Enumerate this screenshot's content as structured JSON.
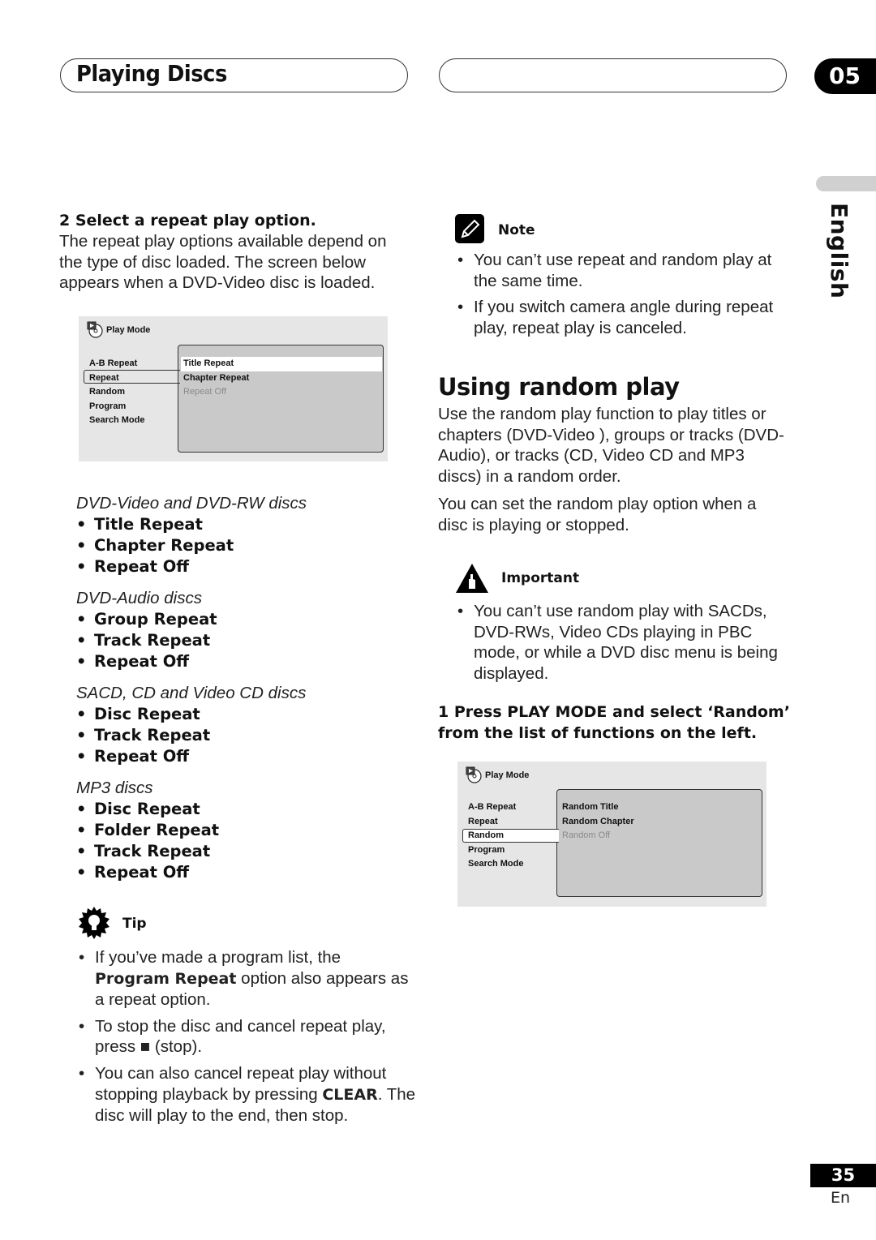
{
  "header": {
    "section_title": "Playing Discs",
    "chapter_number": "05",
    "language_tab": "English"
  },
  "left": {
    "step2_heading": "2   Select a repeat play option.",
    "step2_body": "The repeat play options available depend on the type of disc loaded. The screen below appears when a DVD-Video disc is loaded.",
    "osd": {
      "title": "Play Mode",
      "menu": [
        "A-B Repeat",
        "Repeat",
        "Random",
        "Program",
        "Search Mode"
      ],
      "selected_menu_index": 1,
      "options": [
        {
          "label": "Title Repeat",
          "state": "highlighted"
        },
        {
          "label": "Chapter Repeat",
          "state": "normal"
        },
        {
          "label": "Repeat Off",
          "state": "disabled"
        }
      ]
    },
    "disc_groups": [
      {
        "heading": "DVD-Video and DVD-RW discs",
        "items": [
          "Title Repeat",
          "Chapter Repeat",
          "Repeat Off"
        ]
      },
      {
        "heading": "DVD-Audio discs",
        "items": [
          "Group Repeat",
          "Track Repeat",
          "Repeat Off"
        ]
      },
      {
        "heading": "SACD, CD and Video CD discs",
        "items": [
          "Disc Repeat",
          "Track Repeat",
          "Repeat Off"
        ]
      },
      {
        "heading": "MP3 discs",
        "items": [
          "Disc Repeat",
          "Folder Repeat",
          "Track Repeat",
          "Repeat Off"
        ]
      }
    ],
    "tip": {
      "label": "Tip",
      "items": [
        {
          "pre": "If you’ve made a program list, the ",
          "bold": "Program Repeat",
          "post": " option also appears as a repeat option."
        },
        {
          "pre": "To stop the disc and cancel repeat play, press ",
          "bold": "■",
          "post": " (stop)."
        },
        {
          "pre": "You can also cancel repeat play without stopping playback by pressing ",
          "bold": "CLEAR",
          "post": ". The disc will play to the end, then stop."
        }
      ]
    }
  },
  "right": {
    "note": {
      "label": "Note",
      "items": [
        "You can’t use repeat and random play at the same time.",
        "If you switch camera angle during repeat play, repeat play is canceled."
      ]
    },
    "section_heading": "Using random play",
    "para1": "Use the random play function to play titles or chapters (DVD-Video ), groups or tracks (DVD-Audio), or tracks (CD, Video CD and MP3 discs) in a random order.",
    "para2": "You can set the random play option when a disc is playing or stopped.",
    "important": {
      "label": "Important",
      "items": [
        "You can’t use random play with SACDs, DVD-RWs, Video CDs playing in PBC mode, or while  a DVD disc menu is being displayed."
      ]
    },
    "step1_heading": "1   Press PLAY MODE and select ‘Random’ from the list of functions on the left.",
    "osd": {
      "title": "Play Mode",
      "menu": [
        "A-B Repeat",
        "Repeat",
        "Random",
        "Program",
        "Search Mode"
      ],
      "selected_menu_index": 2,
      "options": [
        {
          "label": "Random Title",
          "state": "normal"
        },
        {
          "label": "Random Chapter",
          "state": "normal"
        },
        {
          "label": "Random Off",
          "state": "disabled"
        }
      ]
    }
  },
  "footer": {
    "page_number": "35",
    "lang_code": "En"
  }
}
